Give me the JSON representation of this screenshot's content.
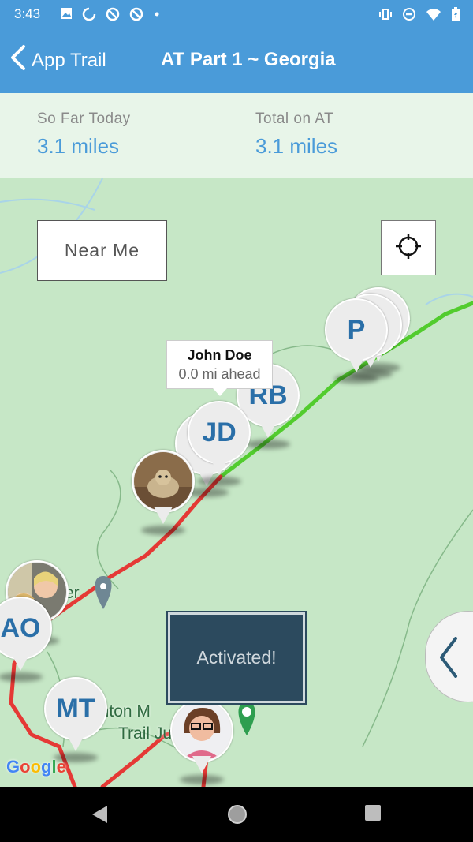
{
  "status_bar": {
    "time": "3:43",
    "left_icons": [
      "image-icon",
      "sync-icon",
      "blocked-icon",
      "blocked-icon",
      "dot-icon"
    ],
    "right_icons": [
      "vibrate-icon",
      "dnd-icon",
      "wifi-icon",
      "battery-icon"
    ]
  },
  "app_bar": {
    "back_label": "App Trail",
    "title": "AT Part 1 ~ Georgia"
  },
  "stats": {
    "today_label": "So Far Today",
    "today_value": "3.1 miles",
    "total_label": "Total on AT",
    "total_value": "3.1 miles"
  },
  "map": {
    "near_me_label": "Near Me",
    "locate_icon": "crosshair-icon",
    "tooltip": {
      "name": "John Doe",
      "distance": "0.0 mi ahead"
    },
    "pins": [
      {
        "initials": "P"
      },
      {
        "initials": "RB"
      },
      {
        "initials": "JD"
      },
      {
        "initials": "AO"
      },
      {
        "initials": "MT"
      }
    ],
    "photo_pins": [
      "dog-photo-pin",
      "selfie-pin",
      "woman-glasses-pin"
    ],
    "toast": "Activated!",
    "labels": {
      "place_partial_1": "enton M",
      "place_partial_2": "Trail Ju",
      "place_partial_3": "er"
    },
    "google": [
      "G",
      "o",
      "o",
      "g",
      "l",
      "e"
    ],
    "colors": {
      "hiked_path": "#e53935",
      "ahead_path": "#52cc2e",
      "pin_text": "#2a6fa8",
      "accent": "#4a9bd9"
    }
  },
  "nav_bar": {
    "icons": [
      "back-triangle-icon",
      "home-circle-icon",
      "recents-square-icon"
    ]
  }
}
